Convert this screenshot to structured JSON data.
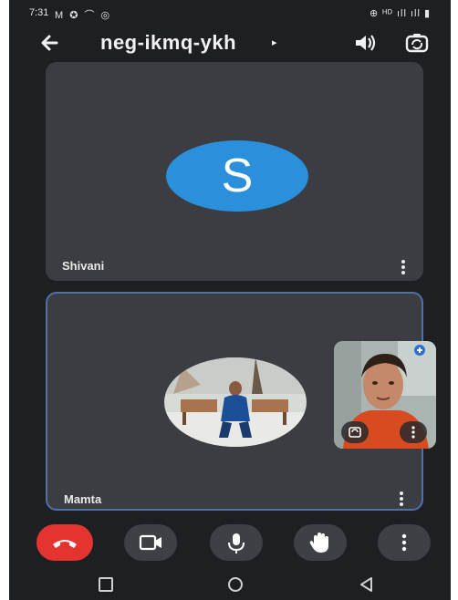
{
  "status_bar": {
    "time": "7:31",
    "left_icons": "M ✪ ⌒ ◎",
    "right_icons": "⊕ ᴴᴰ ıll ıll ▮"
  },
  "meeting": {
    "code": "neg-ikmq-ykh",
    "caret": "▸"
  },
  "participants": [
    {
      "name": "Shivani",
      "avatar_letter": "S",
      "avatar_color": "#2b90db"
    },
    {
      "name": "Mamta",
      "avatar": "photo"
    }
  ],
  "controls": [
    {
      "name": "end-call",
      "icon": "phone-hangup-icon",
      "color": "#e5342f"
    },
    {
      "name": "camera",
      "icon": "video-camera-icon"
    },
    {
      "name": "microphone",
      "icon": "microphone-icon"
    },
    {
      "name": "raise-hand",
      "icon": "hand-icon"
    },
    {
      "name": "more-options",
      "icon": "more-vertical-icon"
    }
  ],
  "colors": {
    "background": "#1d1f22",
    "tile": "#3b3d42",
    "active_border": "#5170a6"
  }
}
